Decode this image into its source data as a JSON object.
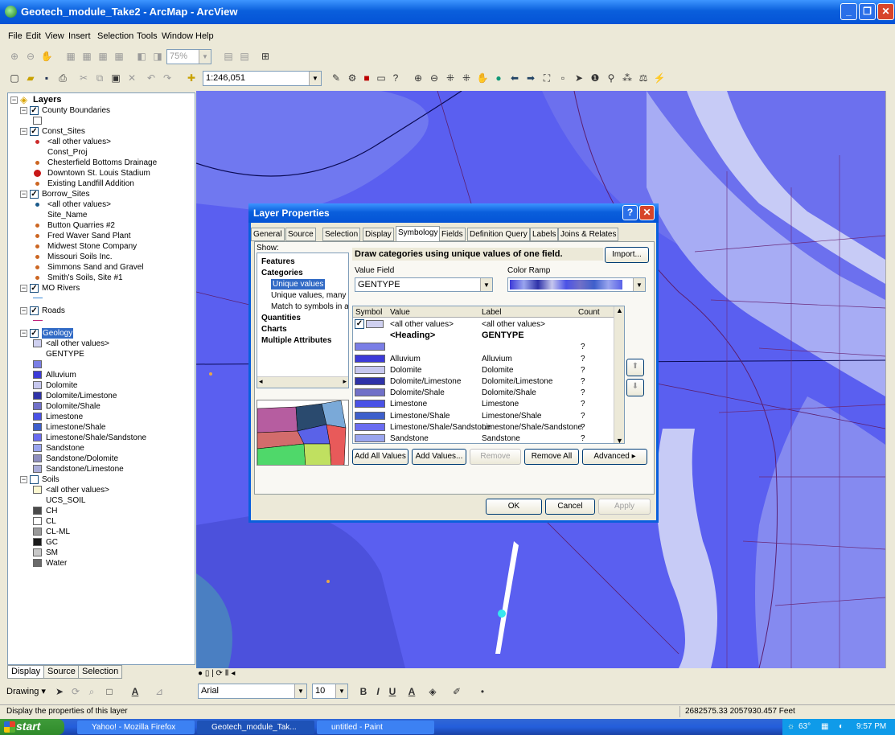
{
  "window": {
    "title": "Geotech_module_Take2 - ArcMap - ArcView"
  },
  "menus": [
    "File",
    "Edit",
    "View",
    "Insert",
    "Selection",
    "Tools",
    "Window",
    "Help"
  ],
  "toolbar": {
    "zoom_percent": "75%",
    "scale": "1:246,051"
  },
  "toc": {
    "root": "Layers",
    "layers": [
      {
        "name": "County Boundaries",
        "checked": true
      },
      {
        "name": "Const_Sites",
        "checked": true,
        "items": [
          "<all other values>",
          "Const_Proj",
          "Chesterfield Bottoms Drainage",
          "Downtown St. Louis Stadium",
          "Existing Landfill Addition"
        ]
      },
      {
        "name": "Borrow_Sites",
        "checked": true,
        "items": [
          "<all other values>",
          "Site_Name",
          "Button Quarries #2",
          "Fred Waver Sand Plant",
          "Midwest Stone Company",
          "Missouri Soils Inc.",
          "Simmons Sand and Gravel",
          "Smith's Soils, Site #1"
        ]
      },
      {
        "name": "MO Rivers",
        "checked": true
      },
      {
        "name": "Roads",
        "checked": true
      },
      {
        "name": "Geology",
        "checked": true,
        "items": [
          "<all other values>",
          "GENTYPE",
          "",
          "Alluvium",
          "Dolomite",
          "Dolomite/Limestone",
          "Dolomite/Shale",
          "Limestone",
          "Limestone/Shale",
          "Limestone/Shale/Sandstone",
          "Sandstone",
          "Sandstone/Dolomite",
          "Sandstone/Limestone"
        ],
        "colors": [
          "#cfd0f0",
          "",
          "#7a7ee6",
          "#3c3ad8",
          "#c6c7ee",
          "#2f33a8",
          "#7070c8",
          "#4a52e6",
          "#3e5fcb",
          "#6a6cf0",
          "#9aa5ee",
          "#8f8fbf",
          "#a9acd8"
        ]
      },
      {
        "name": "Soils",
        "checked": false,
        "items": [
          "<all other values>",
          "UCS_SOIL",
          "CH",
          "CL",
          "CL-ML",
          "GC",
          "SM",
          "Water"
        ],
        "colors": [
          "#fbf7d0",
          "",
          "#4a4a4a",
          "#ffffff",
          "#9a9a9a",
          "#1a1a1a",
          "#c8c8c8",
          "#6a6a6a"
        ]
      }
    ],
    "tabs": [
      "Display",
      "Source",
      "Selection"
    ]
  },
  "dialog": {
    "title": "Layer Properties",
    "tabs": [
      "General",
      "Source",
      "Selection",
      "Display",
      "Symbology",
      "Fields",
      "Definition Query",
      "Labels",
      "Joins & Relates"
    ],
    "show_label": "Show:",
    "show_tree": [
      "Features",
      "Categories",
      "Unique values",
      "Unique values, many f",
      "Match to symbols in a",
      "Quantities",
      "Charts",
      "Multiple Attributes"
    ],
    "description": "Draw categories using unique values of one field.",
    "import": "Import...",
    "value_field_label": "Value Field",
    "value_field": "GENTYPE",
    "color_ramp_label": "Color Ramp",
    "headers": [
      "Symbol",
      "Value",
      "Label",
      "Count"
    ],
    "rows": [
      {
        "value": "<all other values>",
        "label": "<all other values>",
        "count": "",
        "color": "#cfd0f0"
      },
      {
        "value": "<Heading>",
        "label": "GENTYPE",
        "count": "",
        "color": ""
      },
      {
        "value": "",
        "label": "",
        "count": "?",
        "color": "#7a7ee6"
      },
      {
        "value": "Alluvium",
        "label": "Alluvium",
        "count": "?",
        "color": "#3c3ad8"
      },
      {
        "value": "Dolomite",
        "label": "Dolomite",
        "count": "?",
        "color": "#c6c7ee"
      },
      {
        "value": "Dolomite/Limestone",
        "label": "Dolomite/Limestone",
        "count": "?",
        "color": "#2f33a8"
      },
      {
        "value": "Dolomite/Shale",
        "label": "Dolomite/Shale",
        "count": "?",
        "color": "#7070c8"
      },
      {
        "value": "Limestone",
        "label": "Limestone",
        "count": "?",
        "color": "#4a52e6"
      },
      {
        "value": "Limestone/Shale",
        "label": "Limestone/Shale",
        "count": "?",
        "color": "#3e5fcb"
      },
      {
        "value": "Limestone/Shale/Sandstone",
        "label": "Limestone/Shale/Sandstone",
        "count": "?",
        "color": "#6a6cf0"
      },
      {
        "value": "Sandstone",
        "label": "Sandstone",
        "count": "?",
        "color": "#9aa5ee"
      }
    ],
    "buttons": {
      "add_all": "Add All Values",
      "add_values": "Add Values...",
      "remove": "Remove",
      "remove_all": "Remove All",
      "advanced": "Advanced",
      "ok": "OK",
      "cancel": "Cancel",
      "apply": "Apply"
    }
  },
  "drawing": {
    "label": "Drawing",
    "font": "Arial",
    "size": "10"
  },
  "status": {
    "message": "Display the properties of this layer",
    "coords": "2682575.33  2057930.457 Feet"
  },
  "taskbar": {
    "start": "start",
    "tasks": [
      "Yahoo! - Mozilla Firefox",
      "Geotech_module_Tak...",
      "untitled - Paint"
    ],
    "time": "9:57 PM",
    "temp": "63°"
  }
}
